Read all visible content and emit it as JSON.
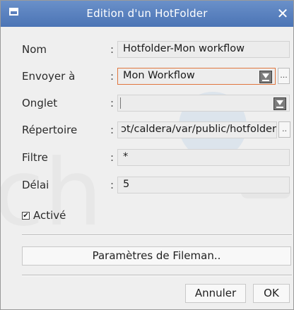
{
  "window": {
    "title": "Edition d'un HotFolder",
    "close_glyph": "✕"
  },
  "form": {
    "nom": {
      "label": "Nom",
      "value": "Hotfolder-Mon workflow"
    },
    "envoyer": {
      "label": "Envoyer à",
      "value": "Mon Workflow",
      "more": "..."
    },
    "onglet": {
      "label": "Onglet",
      "value": ""
    },
    "repertoire": {
      "label": "Répertoire",
      "value": "ɔt/caldera/var/public/hotfolder",
      "more": ".."
    },
    "filtre": {
      "label": "Filtre",
      "value": "*"
    },
    "delai": {
      "label": "Délai",
      "value": "5"
    },
    "colon": ":"
  },
  "active": {
    "label": "Activé",
    "checked": true,
    "mark": "✔"
  },
  "buttons": {
    "fileman": "Paramètres de Fileman..",
    "cancel": "Annuler",
    "ok": "OK"
  },
  "colors": {
    "titlebar": "#5a82c2",
    "focus_border": "#e0763e",
    "background": "#efefef"
  }
}
